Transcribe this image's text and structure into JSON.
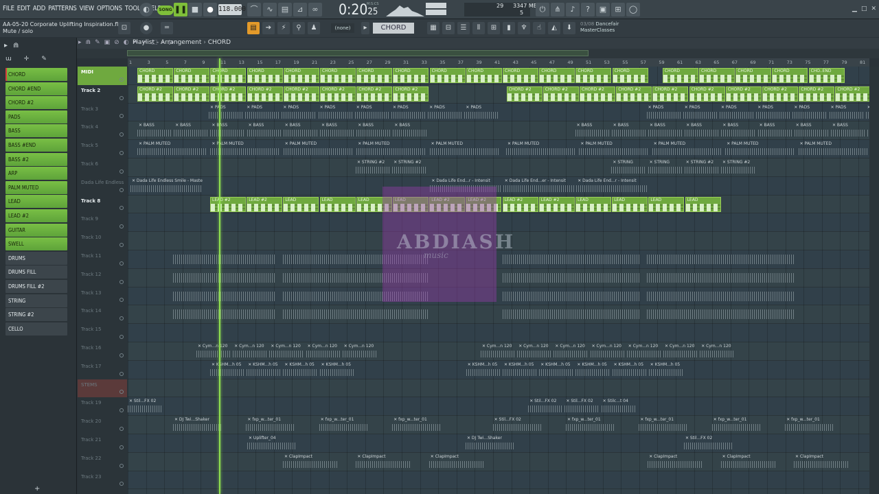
{
  "menu": [
    "FILE",
    "EDIT",
    "ADD",
    "PATTERNS",
    "VIEW",
    "OPTIONS",
    "TOOLS",
    "HELP"
  ],
  "transport": {
    "song_label": "SONG",
    "tempo": "118.000",
    "time": "0:20",
    "time_frac": "25",
    "mcs": "M:S:CS"
  },
  "monitor": {
    "cpu": "29",
    "memory": "3347 MB",
    "poly": "5"
  },
  "project": {
    "file": "AA-05-20 Corporate Uplifting Inspiration.flp",
    "hint": "Mute / solo"
  },
  "toolbar": {
    "none_label": "(none)",
    "pattern": "CHORD"
  },
  "news": {
    "index": "03/08",
    "title": "Dancefair",
    "subtitle": "MasterClasses"
  },
  "playlist": {
    "title": "Playlist - Arrangement",
    "pattern": "CHORD"
  },
  "channels": [
    {
      "name": "CHORD",
      "style": "green sel"
    },
    {
      "name": "CHORD #END",
      "style": "green"
    },
    {
      "name": "CHORD #2",
      "style": "green"
    },
    {
      "name": "PADS",
      "style": "green"
    },
    {
      "name": "BASS",
      "style": "green"
    },
    {
      "name": "BASS #END",
      "style": "green"
    },
    {
      "name": "BASS #2",
      "style": "green"
    },
    {
      "name": "ARP",
      "style": "green"
    },
    {
      "name": "PALM MUTED",
      "style": "green"
    },
    {
      "name": "LEAD",
      "style": "green"
    },
    {
      "name": "LEAD #2",
      "style": "green"
    },
    {
      "name": "GUITAR",
      "style": "green"
    },
    {
      "name": "SWELL",
      "style": "green"
    },
    {
      "name": "DRUMS",
      "style": "dark"
    },
    {
      "name": "DRUMS FILL",
      "style": "dark"
    },
    {
      "name": "DRUMS FILL #2",
      "style": "dark"
    },
    {
      "name": "STRING",
      "style": "dark"
    },
    {
      "name": "STRING #2",
      "style": "dark"
    },
    {
      "name": "CELLO",
      "style": "dark"
    }
  ],
  "ruler": [
    "1",
    "3",
    "5",
    "7",
    "9",
    "11",
    "13",
    "15",
    "17",
    "19",
    "21",
    "23",
    "25",
    "27",
    "29",
    "31",
    "33",
    "35",
    "37",
    "39",
    "41",
    "43",
    "45",
    "47",
    "49",
    "51",
    "53",
    "55",
    "57",
    "59",
    "61",
    "63",
    "65",
    "67",
    "69",
    "71",
    "73",
    "75",
    "77",
    "79",
    "81"
  ],
  "tracks": [
    {
      "name": "MIDI",
      "active": true
    },
    {
      "name": "Track 2",
      "active": true
    },
    {
      "name": "Track 3"
    },
    {
      "name": "Track 4"
    },
    {
      "name": "Track 5"
    },
    {
      "name": "Track 6"
    },
    {
      "name": "Dada Life Endless"
    },
    {
      "name": "Track 8",
      "active": true
    },
    {
      "name": "Track 9"
    },
    {
      "name": "Track 10"
    },
    {
      "name": "Track 11"
    },
    {
      "name": "Track 12"
    },
    {
      "name": "Track 13"
    },
    {
      "name": "Track 14"
    },
    {
      "name": "Track 15"
    },
    {
      "name": "Track 16"
    },
    {
      "name": "Track 17"
    },
    {
      "name": "STEMS"
    },
    {
      "name": "Track 19"
    },
    {
      "name": "Track 20"
    },
    {
      "name": "Track 21"
    },
    {
      "name": "Track 22"
    },
    {
      "name": "Track 23"
    }
  ],
  "clips": {
    "row0": [
      "CHORD",
      "CHORD",
      "CHORD",
      "CHORD",
      "CHORD",
      "CHORD",
      "CHORD",
      "CHORD",
      "CHORD",
      "CHORD",
      "CHORD",
      "CHORD",
      "CHORD",
      "CHORD",
      "CHORD",
      "CHORD",
      "CHORD",
      "CHORD",
      "CHO..END"
    ],
    "row1": [
      "CHORD #2",
      "CHORD #2",
      "CHORD #2",
      "CHORD #2",
      "CHORD #2",
      "CHORD #2",
      "CHORD #2",
      "CHORD #2",
      "CHORD #2",
      "CHORD #2",
      "CHORD #2",
      "CHORD #2",
      "CHORD #2",
      "CHORD #2",
      "CHORD #2",
      "CHORD #2",
      "CHORD #2",
      "CHORD #2"
    ],
    "row2": [
      "PADS",
      "PADS",
      "PADS",
      "PADS",
      "PADS",
      "PADS",
      "PADS",
      "PADS",
      "PADS",
      "PADS",
      "PADS",
      "PADS",
      "PADS",
      "PADS",
      "PADS",
      "PADS",
      "PADS"
    ],
    "row3": [
      "BASS",
      "BASS",
      "BASS",
      "BASS",
      "BASS",
      "BASS",
      "BASS",
      "BASS",
      "BASS",
      "BASS",
      "BASS",
      "BASS",
      "BASS",
      "BASS",
      "BASS",
      "BASS",
      "BASS",
      "BASS",
      "BAS..END"
    ],
    "row4": [
      "PALM MUTED",
      "PALM MUTED",
      "PALM MUTED",
      "PALM MUTED",
      "PALM MUTED",
      "PALM MUTED",
      "PALM MUTED",
      "PALM MUTED",
      "PALM MUTED",
      "PALM MUTED"
    ],
    "row5": [
      "STRING #2",
      "STRING #2",
      "STRING",
      "STRING",
      "STRING #2",
      "STRING #2"
    ],
    "row6": [
      "Dada Life Endless Smile - Master - Intensit",
      "Dada Life End...r - Intensit",
      "Dada Life End...er - Intensit",
      "Dada Life End...r - Intensit"
    ],
    "row7": [
      "LEAD #2",
      "LEAD #2",
      "LEAD",
      "LEAD",
      "LEAD",
      "LEAD",
      "LEAD #2",
      "LEAD #2",
      "LEAD #2",
      "LEAD #2",
      "LEAD",
      "LEAD",
      "LEAD",
      "LEAD"
    ],
    "row15": [
      "Cym...n 120",
      "Cym...n 120",
      "Cym...n 120",
      "Cym...n 120",
      "Cym...n 120",
      "Cym...n 120",
      "Cym...n 120",
      "Cym...n 120",
      "Cym...n 120",
      "Cym...n 120",
      "Cym...n 120",
      "Cym...n 120"
    ],
    "row16": [
      "KSHM...h 05",
      "KSHM...h 05",
      "KSHM...h 05",
      "KSHM...h 05",
      "KSHM...h 05",
      "KSHM...h 05",
      "KSHM...h 05",
      "KSHM...h 05",
      "KSHM...h 05",
      "KSHM...h 05"
    ],
    "row18": [
      "Stil...FX 02",
      "Stil...FX 02",
      "Stil...FX 02",
      "Stilc...t 04"
    ],
    "row19": [
      "DJ Twi...Shaker",
      "fxp_w...ter_01",
      "fxp_w...ter_01",
      "fxp_w...ter_01",
      "Stil...FX 02",
      "fxp_w...ter_01",
      "fxp_w...ter_01",
      "fxp_w...ter_01",
      "fxp_w...ter_01"
    ],
    "row20": [
      "Uplifter_04",
      "DJ Twi...Shaker",
      "Stil...FX 02"
    ],
    "row21": [
      "ClapImpact",
      "ClapImpact",
      "ClapImpact",
      "ClapImpact",
      "ClapImpact",
      "ClapImpact"
    ]
  },
  "watermark": {
    "title": "ABDIASH",
    "sub": "music"
  }
}
